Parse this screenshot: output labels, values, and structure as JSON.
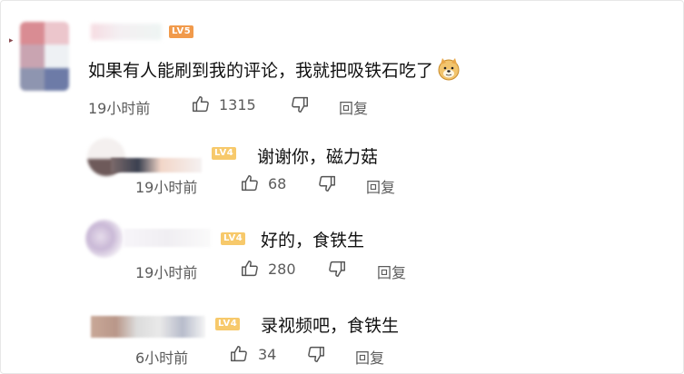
{
  "main_comment": {
    "badge": "LV5",
    "text": "如果有人能刷到我的评论，我就把吸铁石吃了",
    "time": "19小时前",
    "likes": "1315",
    "reply_label": "回复"
  },
  "replies": [
    {
      "badge": "LV4",
      "text": "谢谢你，磁力菇",
      "time": "19小时前",
      "likes": "68",
      "reply_label": "回复"
    },
    {
      "badge": "LV4",
      "text": "好的，食铁生",
      "time": "19小时前",
      "likes": "280",
      "reply_label": "回复"
    },
    {
      "badge": "LV4",
      "text": "录视频吧，食铁生",
      "time": "6小时前",
      "likes": "34",
      "reply_label": "回复"
    }
  ],
  "icons": {
    "like": "thumbs-up-icon",
    "dislike": "thumbs-down-icon",
    "emoji": "doge-emoji-icon"
  },
  "colors": {
    "badge_lv5": "#f19a4b",
    "badge_lv4": "#f7c96b",
    "meta_text": "#5b5b5b"
  }
}
